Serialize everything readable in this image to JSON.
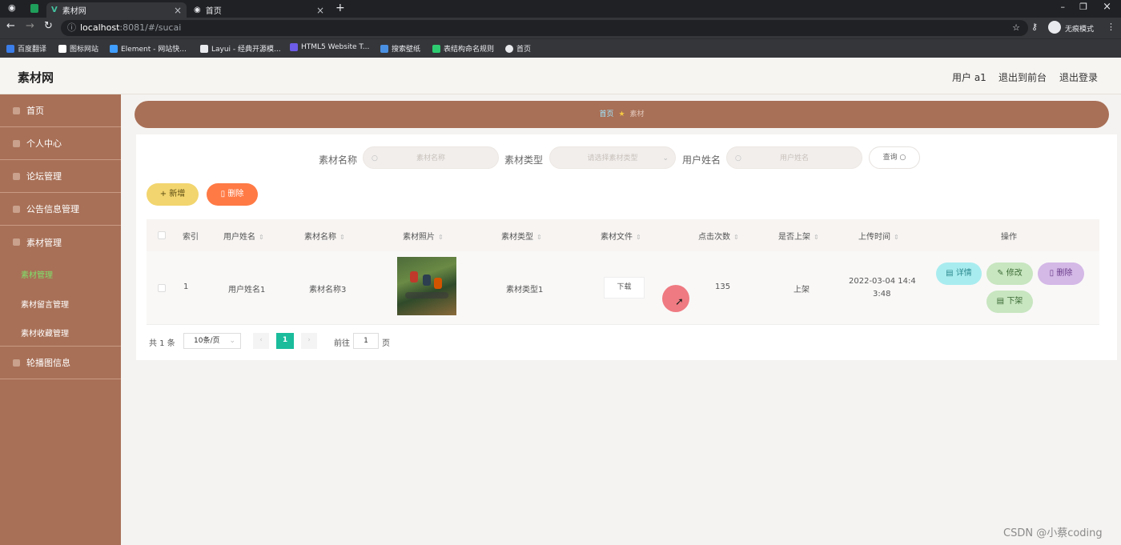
{
  "browser": {
    "tabs": [
      {
        "title": "素材网"
      },
      {
        "title": "首页"
      }
    ],
    "url_host": "localhost",
    "url_path": ":8081/#/sucai",
    "profile": "无痕模式",
    "bookmarks": [
      {
        "label": "百度翻译",
        "color": "#3b7de9"
      },
      {
        "label": "图标网站",
        "color": "#ffffff"
      },
      {
        "label": "Element - 网站快...",
        "color": "#409eff"
      },
      {
        "label": "Layui - 经典开源模...",
        "color": "#e8eaed"
      },
      {
        "label": "HTML5 Website T...",
        "color": "#6c5ce7"
      },
      {
        "label": "搜索壁纸",
        "color": "#4a90e2"
      },
      {
        "label": "表结构命名规则",
        "color": "#2ecc71"
      },
      {
        "label": "首页",
        "color": "#e8eaed"
      }
    ]
  },
  "header": {
    "logo": "素材网",
    "user": "用户 a1",
    "to_front": "退出到前台",
    "logout": "退出登录"
  },
  "sidebar": {
    "items": [
      {
        "label": "首页"
      },
      {
        "label": "个人中心"
      },
      {
        "label": "论坛管理"
      },
      {
        "label": "公告信息管理"
      },
      {
        "label": "素材管理"
      },
      {
        "label": "轮播图信息"
      }
    ],
    "subitems": [
      {
        "label": "素材管理",
        "active": true
      },
      {
        "label": "素材留言管理",
        "active": false
      },
      {
        "label": "素材收藏管理",
        "active": false
      }
    ]
  },
  "breadcrumb": {
    "home": "首页",
    "current": "素材"
  },
  "filters": {
    "name_label": "素材名称",
    "name_placeholder": "素材名称",
    "type_label": "素材类型",
    "type_placeholder": "请选择素材类型",
    "user_label": "用户姓名",
    "user_placeholder": "用户姓名",
    "query": "查询"
  },
  "actions": {
    "add": "新增",
    "delete": "删除"
  },
  "table": {
    "columns": [
      "索引",
      "用户姓名",
      "素材名称",
      "素材照片",
      "素材类型",
      "素材文件",
      "点击次数",
      "是否上架",
      "上传时间",
      "操作"
    ],
    "rows": [
      {
        "index": "1",
        "user": "用户姓名1",
        "name": "素材名称3",
        "type": "素材类型1",
        "file": "下载",
        "clicks": "135",
        "status": "上架",
        "time_1": "2022-03-04 14:4",
        "time_2": "3:48",
        "ops": {
          "detail": "详情",
          "edit": "修改",
          "delete": "删除",
          "offshelf": "下架"
        }
      }
    ]
  },
  "pagination": {
    "total": "共 1 条",
    "size": "10条/页",
    "page": "1",
    "goto": "前往",
    "goto_value": "1",
    "page_unit": "页"
  },
  "watermark": "CSDN @小蔡coding",
  "colors": {
    "sidebar": "#a87057",
    "accent_green": "#1abc9c",
    "add_btn": "#f2d56e",
    "delete_btn": "#ff7a45"
  }
}
